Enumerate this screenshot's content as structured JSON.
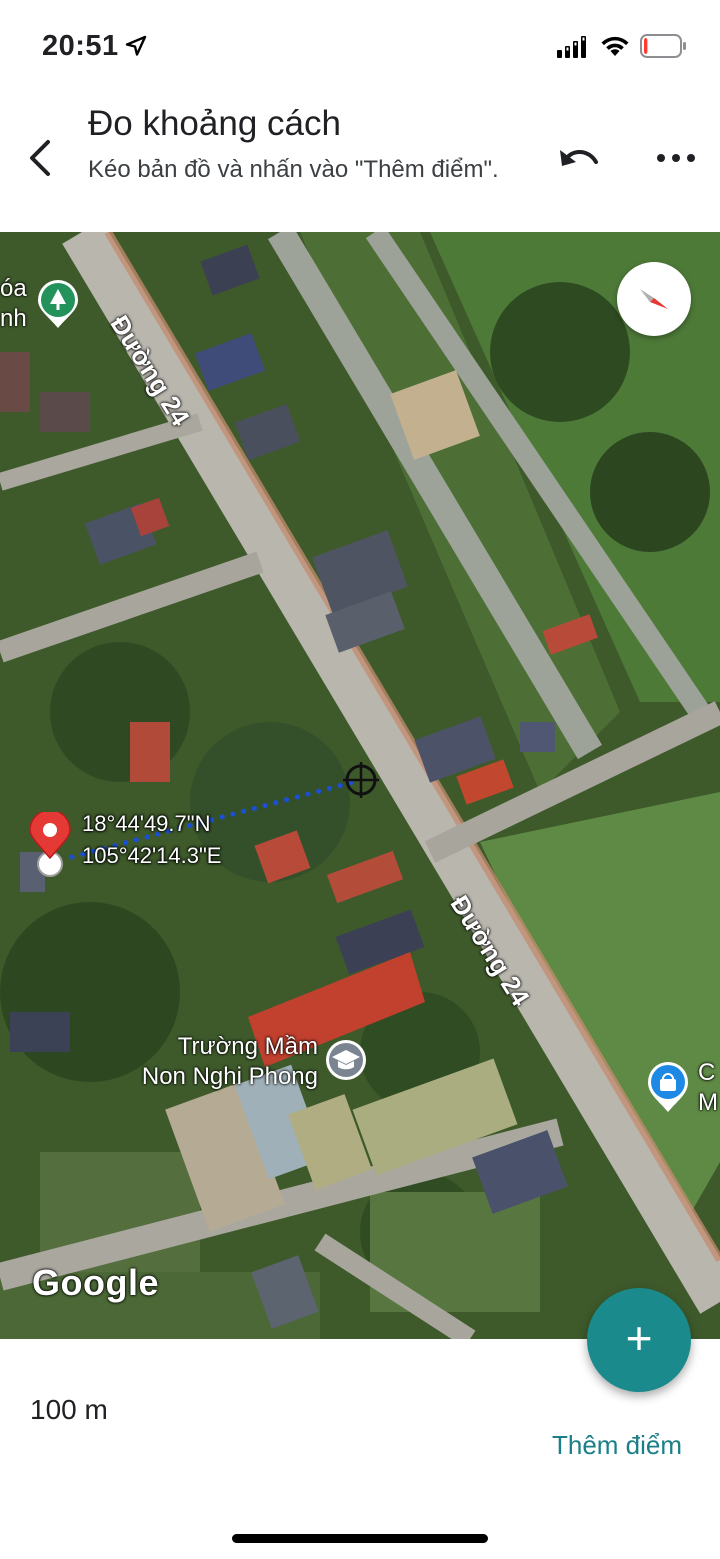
{
  "status_bar": {
    "time": "20:51",
    "battery_level": 0.1,
    "battery_color": "#ff3b30"
  },
  "header": {
    "title": "Đo khoảng cách",
    "subtitle": "Kéo bản đồ và nhấn vào \"Thêm điểm\".",
    "back_icon": "arrow-back-icon",
    "undo_icon": "undo-icon",
    "more_icon": "more-dots-icon"
  },
  "map": {
    "road_labels": [
      "Đường 24",
      "Đường 24"
    ],
    "places": {
      "school": "Trường Mầm\nNon Nghi Phong",
      "top_left_partial": "óa\nnh",
      "right_partial": "C\nM"
    },
    "coordinates": {
      "lat": "18°44'49.7\"N",
      "lng": "105°42'14.3\"E"
    },
    "attribution": "Google",
    "measure_line_color": "#1a4fd6",
    "pin_color": "#e53935"
  },
  "bottom": {
    "distance": "100 m",
    "add_point_label": "Thêm điểm",
    "fab_symbol": "+",
    "fab_color": "#1a8a8c"
  }
}
